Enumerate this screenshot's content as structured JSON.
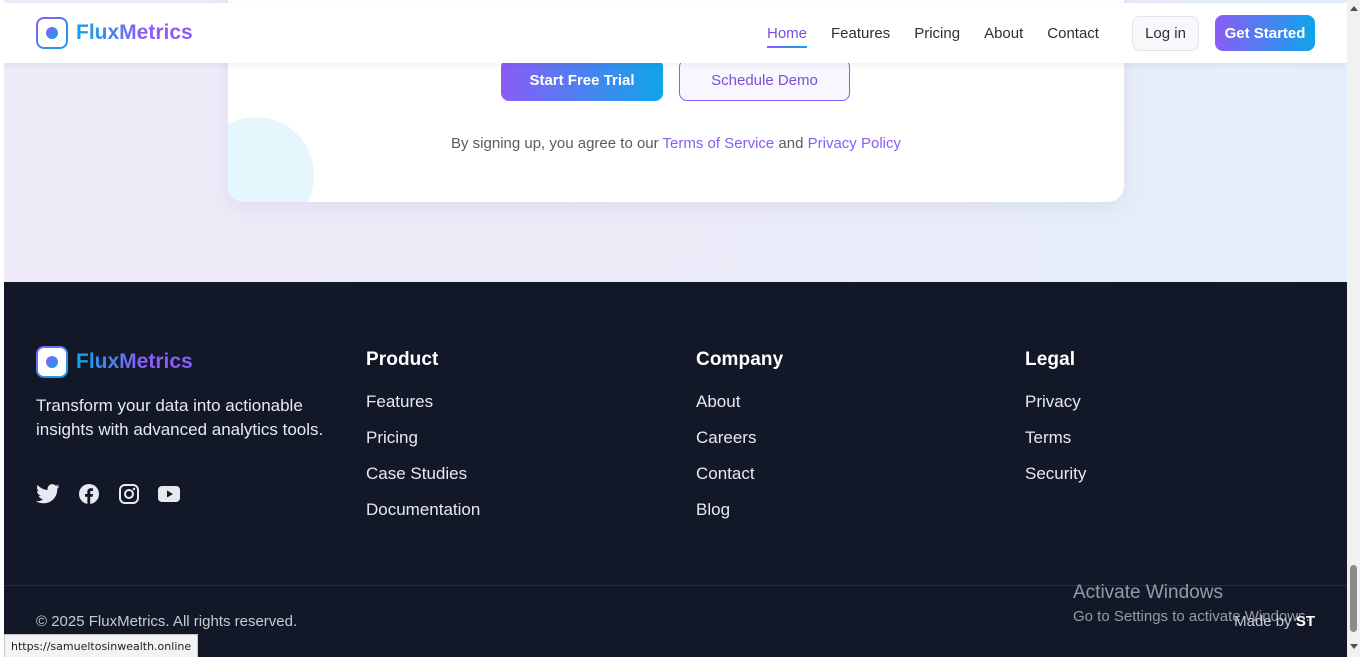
{
  "header": {
    "brand": "FluxMetrics",
    "nav": [
      {
        "label": "Home",
        "active": true
      },
      {
        "label": "Features"
      },
      {
        "label": "Pricing"
      },
      {
        "label": "About"
      },
      {
        "label": "Contact"
      }
    ],
    "login_label": "Log in",
    "cta_label": "Get Started"
  },
  "cta": {
    "primary_label": "Start Free Trial",
    "secondary_label": "Schedule Demo",
    "terms_prefix": "By signing up, you agree to our",
    "terms_link": "Terms of Service",
    "terms_and": "and",
    "privacy_link": "Privacy Policy"
  },
  "footer": {
    "brand": "FluxMetrics",
    "tagline": "Transform your data into actionable insights with advanced analytics tools.",
    "socials": [
      "twitter-icon",
      "facebook-icon",
      "instagram-icon",
      "youtube-icon"
    ],
    "columns": [
      {
        "title": "Product",
        "items": [
          "Features",
          "Pricing",
          "Case Studies",
          "Documentation"
        ]
      },
      {
        "title": "Company",
        "items": [
          "About",
          "Careers",
          "Contact",
          "Blog"
        ]
      },
      {
        "title": "Legal",
        "items": [
          "Privacy",
          "Terms",
          "Security"
        ]
      }
    ],
    "copyright": "© 2025 FluxMetrics. All rights reserved.",
    "made_by_prefix": "Made by",
    "made_by_name": "ST"
  },
  "overlay": {
    "activate_title": "Activate Windows",
    "activate_subtitle": "Go to Settings to activate Windows.",
    "status_url": "https://samueltosinwealth.online"
  },
  "colors": {
    "accent_purple": "#8b5cf6",
    "accent_blue": "#0ea5e9",
    "footer_bg": "#121828"
  }
}
